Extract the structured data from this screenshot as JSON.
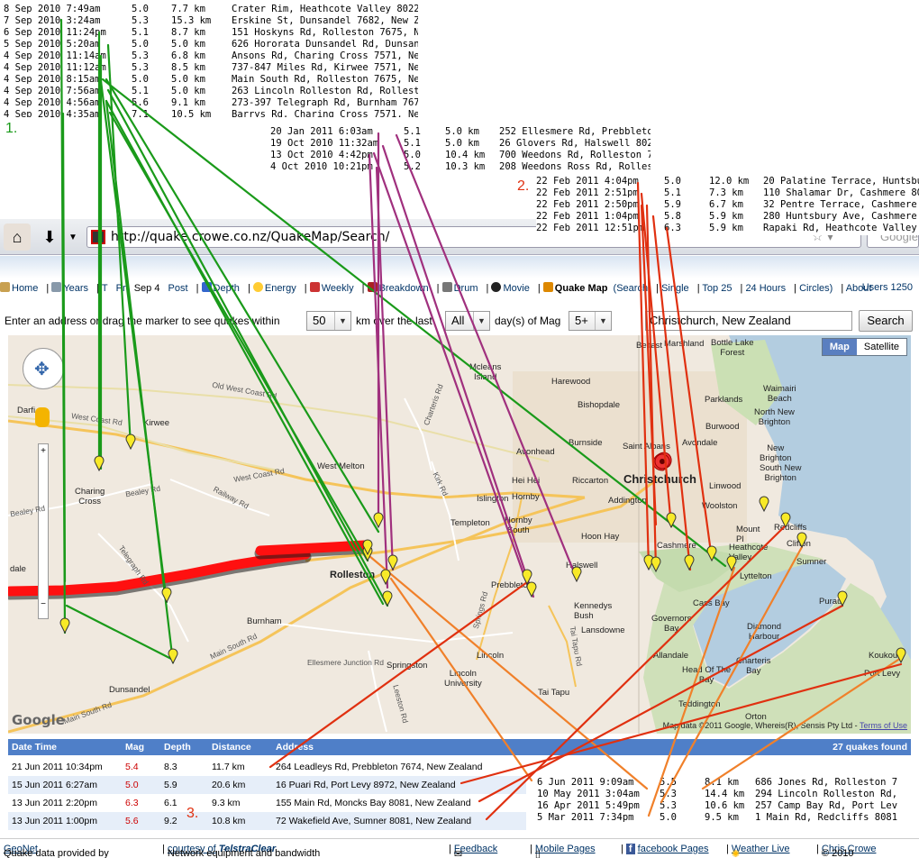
{
  "list1": {
    "index_label": "1.",
    "rows": [
      [
        "8 Sep 2010 7:49am",
        "5.0",
        "7.7 km",
        "Crater Rim, Heathcote Valley 8022, Ne"
      ],
      [
        "7 Sep 2010 3:24am",
        "5.3",
        "15.3 km",
        "Erskine St, Dunsandel 7682, New Zeala"
      ],
      [
        "6 Sep 2010 11:24pm",
        "5.1",
        "8.7 km",
        "151 Hoskyns Rd, Rolleston 7675, New Z"
      ],
      [
        "5 Sep 2010 5:20am",
        "5.0",
        "5.0 km",
        "626 Hororata Dunsandel Rd, Dunsandel"
      ],
      [
        "4 Sep 2010 11:14am",
        "5.3",
        "6.8 km",
        "Ansons Rd, Charing Cross 7571, New Ze"
      ],
      [
        "4 Sep 2010 11:12am",
        "5.3",
        "8.5 km",
        "737-847 Miles Rd, Kirwee 7571, New Ze"
      ],
      [
        "4 Sep 2010 8:15am",
        "5.0",
        "5.0 km",
        "Main South Rd, Rolleston 7675, New Ze"
      ],
      [
        "4 Sep 2010 7:56am",
        "5.1",
        "5.0 km",
        "263 Lincoln Rolleston Rd, Rolleston 7"
      ],
      [
        "4 Sep 2010 4:56am",
        "5.6",
        "9.1 km",
        "273-397 Telegraph Rd, Burnham 7675, N"
      ],
      [
        "4 Sep 2010 4:35am",
        "7.1",
        "10.5 km",
        "Barrys Rd, Charing Cross 7571, New Ze"
      ]
    ]
  },
  "list_purple": {
    "rows": [
      [
        "20 Jan 2011 6:03am",
        "5.1",
        "5.0 km",
        "252 Ellesmere Rd, Prebbleton 7"
      ],
      [
        "19 Oct 2010 11:32am",
        "5.1",
        "5.0 km",
        "26 Glovers Rd, Halswell 8025, N"
      ],
      [
        "13 Oct 2010 4:42pm",
        "5.0",
        "10.4 km",
        "700 Weedons Rd, Rolleston 7675"
      ],
      [
        "4 Oct 2010 10:21pm",
        "5.2",
        "10.3 km",
        "208 Weedons Ross Rd, Rolleston"
      ]
    ]
  },
  "list2": {
    "index_label": "2.",
    "rows": [
      [
        "22 Feb 2011 4:04pm",
        "5.0",
        "12.0 km",
        "20 Palatine Terrace, Huntsbury"
      ],
      [
        "22 Feb 2011 2:51pm",
        "5.1",
        "7.3 km",
        "110 Shalamar Dr, Cashmere 8022"
      ],
      [
        "22 Feb 2011 2:50pm",
        "5.9",
        "6.7 km",
        "32 Pentre Terrace, Cashmere 802"
      ],
      [
        "22 Feb 2011 1:04pm",
        "5.8",
        "5.9 km",
        "280 Huntsbury Ave, Cashmere 802"
      ],
      [
        "22 Feb 2011 12:51pm",
        "6.3",
        "5.9 km",
        "Rapaki Rd, Heathcote Valley 802"
      ]
    ]
  },
  "list_orange": {
    "rows": [
      [
        "6 Jun 2011 9:09am",
        "5.5",
        "8.1 km",
        "686 Jones Rd, Rolleston 76"
      ],
      [
        "10 May 2011 3:04am",
        "5.3",
        "14.4 km",
        "294 Lincoln Rolleston Rd, R"
      ],
      [
        "16 Apr 2011 5:49pm",
        "5.3",
        "10.6 km",
        "257 Camp Bay Rd, Port Levy"
      ],
      [
        "5 Mar 2011 7:34pm",
        "5.0",
        "9.5 km",
        "1 Main Rd, Redcliffs 8081,"
      ]
    ]
  },
  "list3_label": "3.",
  "browser": {
    "url": "http://quake.crowe.co.nz/QuakeMap/Search/",
    "search_placeholder": "Google"
  },
  "nav": {
    "items": [
      "Home",
      "Years",
      "T",
      "Pr",
      "Sep 4",
      "Post",
      "Depth",
      "Energy",
      "Weekly",
      "Breakdown",
      "Drum",
      "Movie",
      "Quake Map",
      "(Search",
      "Single",
      "Top 25",
      "24 Hours",
      "Circles)",
      "About"
    ],
    "users": "Users 1250"
  },
  "search": {
    "prefix": "Enter an address or drag the marker to see quakes within",
    "km_value": "50",
    "mid": "km over the last",
    "days_value": "All",
    "suffix": "day(s) of Mag",
    "mag_value": "5+",
    "address": "Christchurch, New Zealand",
    "button": "Search"
  },
  "map": {
    "type_map": "Map",
    "type_sat": "Satellite",
    "attribution": "Map data ©2011 Google, Whereis(R), Sensis Pty Ltd -",
    "terms": "Terms of Use",
    "logo": "Google",
    "places": {
      "christchurch": "Christchurch",
      "rolleston": "Rolleston",
      "west_melton": "West Melton",
      "kirwee": "Kirwee",
      "darfield": "Darfi",
      "charing_cross": "Charing\nCross",
      "burnham": "Burnham",
      "dunsandel": "Dunsandel",
      "templeton": "Templeton",
      "hornby": "Hornby",
      "halswell": "Halswell",
      "prebbleton": "Prebbleton",
      "lincoln": "Lincoln",
      "lincoln_uni": "Lincoln\nUniversity",
      "springston": "Springston",
      "tai_tapu": "Tai Tapu",
      "lyttelton": "Lyttelton",
      "sumner": "Sumner",
      "redcliffs": "Redcliffs",
      "cashmere": "Cashmere",
      "woolston": "Woolston",
      "linwood": "Linwood",
      "new_brighton": "New\nBrighton",
      "parklands": "Parklands",
      "belfast": "Belfast",
      "harewood": "Harewood",
      "bishopdale": "Bishopdale",
      "burnside": "Burnside",
      "riccarton": "Riccarton",
      "avonhead": "Avonhead",
      "hei_hei": "Hei Hei",
      "islington": "Islington",
      "hoon_hay": "Hoon Hay",
      "governors_bay": "Governors\nBay",
      "diamond_harbour": "Diamond\nHarbour",
      "charteris_bay": "Charteris\nBay",
      "teddington": "Teddington",
      "port_levy": "Port Levy",
      "koukourarata": "Koukour",
      "allandale": "Allandale",
      "head_of_bay": "Head Of The\nBay",
      "kennedys_bush": "Kennedys\nBush",
      "lansdowne": "Lansdowne",
      "mcleans": "Mcleans\nIsland",
      "bottle_lake": "Bottle Lake\nForest",
      "waimairi": "Waimairi\nBeach",
      "north_new_brighton": "North New\nBrighton",
      "south_new_brighton": "South New\nBrighton",
      "avondale": "Avondale",
      "burwood": "Burwood",
      "marshland": "Marshland",
      "saint_albans": "Saint Albans",
      "addington": "Addington",
      "mount_pleasant": "Mount\nPl",
      "heathcote": "Heathcote\nValley",
      "clifton": "Clifton",
      "cass_bay": "Cass Bay",
      "dale": "dale",
      "orton": "Orton",
      "purau": "Purau",
      "hornby_south": "Hornby\nSouth"
    },
    "roads": {
      "r1": "Old West Coast Rd",
      "r2": "West Coast Rd",
      "r3": "Main South Rd",
      "r4": "Telegraph Rd",
      "r5": "Ellesmere Junction Rd",
      "r6": "Springs Rd",
      "r7": "Kirk Rd",
      "r8": "Railway Rd",
      "r9": "Bealey Rd",
      "r10": "Leeston Rd",
      "r11": "Tai Tapu Rd",
      "r12": "Charteris Rd",
      "r13": "Main South Rd"
    }
  },
  "table": {
    "headers": [
      "Date Time",
      "Mag",
      "Depth",
      "Distance",
      "Address"
    ],
    "count": "27 quakes found",
    "rows": [
      [
        "21 Jun 2011 10:34pm",
        "5.4",
        "8.3",
        "11.7 km",
        "264 Leadleys Rd, Prebbleton 7674, New Zealand"
      ],
      [
        "15 Jun 2011 6:27am",
        "5.0",
        "5.9",
        "20.6 km",
        "16 Puari Rd, Port Levy 8972, New Zealand"
      ],
      [
        "13 Jun 2011 2:20pm",
        "6.3",
        "6.1",
        "9.3 km",
        "155 Main Rd, Moncks Bay 8081, New Zealand"
      ],
      [
        "13 Jun 2011 1:00pm",
        "5.6",
        "9.2",
        "10.8 km",
        "72 Wakefield Ave, Sumner 8081, New Zealand"
      ]
    ]
  },
  "footer": {
    "a": "Quake data provided by",
    "a_link": "GeoNet",
    "b": "Network equipment and bandwidth",
    "b_link": "courtesy of",
    "b_logo": "TelstraClear",
    "feedback": "Feedback",
    "mobile": "Mobile Pages",
    "facebook": "facebook Pages",
    "weather": "Weather Live",
    "copy": "© 2010",
    "copy_link": "Chris Crowe"
  },
  "colors": {
    "green": "#1a9a1a",
    "purple": "#a0307e",
    "red": "#e03010",
    "orange": "#f0802a",
    "accent_blue": "#4f7fc8"
  }
}
